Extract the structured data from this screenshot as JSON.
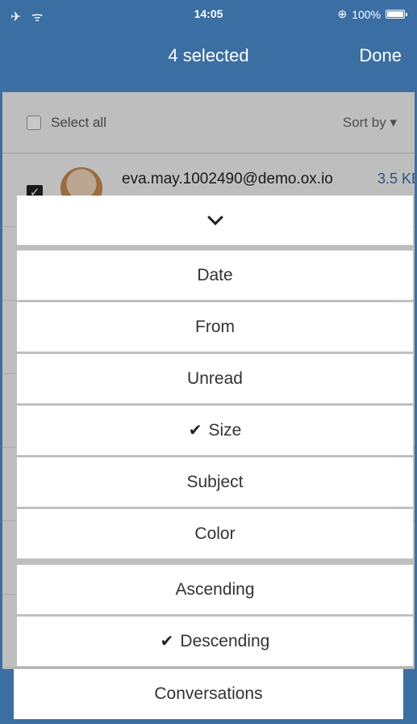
{
  "status_bar": {
    "left": "✈ ᯤ",
    "time": "14:05",
    "battery": "100%"
  },
  "header": {
    "title": "4 selected",
    "done": "Done"
  },
  "toolbar": {
    "select_all": "Select all",
    "sort_by": "Sort by ▾"
  },
  "background_rows": [
    {
      "from": "eva.may.1002490@demo.ox.io",
      "size": "3.5 KB"
    }
  ],
  "sort_sheet": {
    "items": [
      {
        "label": "Date",
        "checked": false
      },
      {
        "label": "From",
        "checked": false
      },
      {
        "label": "Unread",
        "checked": false
      },
      {
        "label": "Size",
        "checked": true
      },
      {
        "label": "Subject",
        "checked": false
      },
      {
        "label": "Color",
        "checked": false
      },
      {
        "label": "Ascending",
        "checked": false
      },
      {
        "label": "Descending",
        "checked": true
      }
    ],
    "conversations": "Conversations"
  },
  "colors": {
    "accent": "#3b6ea2",
    "size_text": "#3b6ea2"
  }
}
